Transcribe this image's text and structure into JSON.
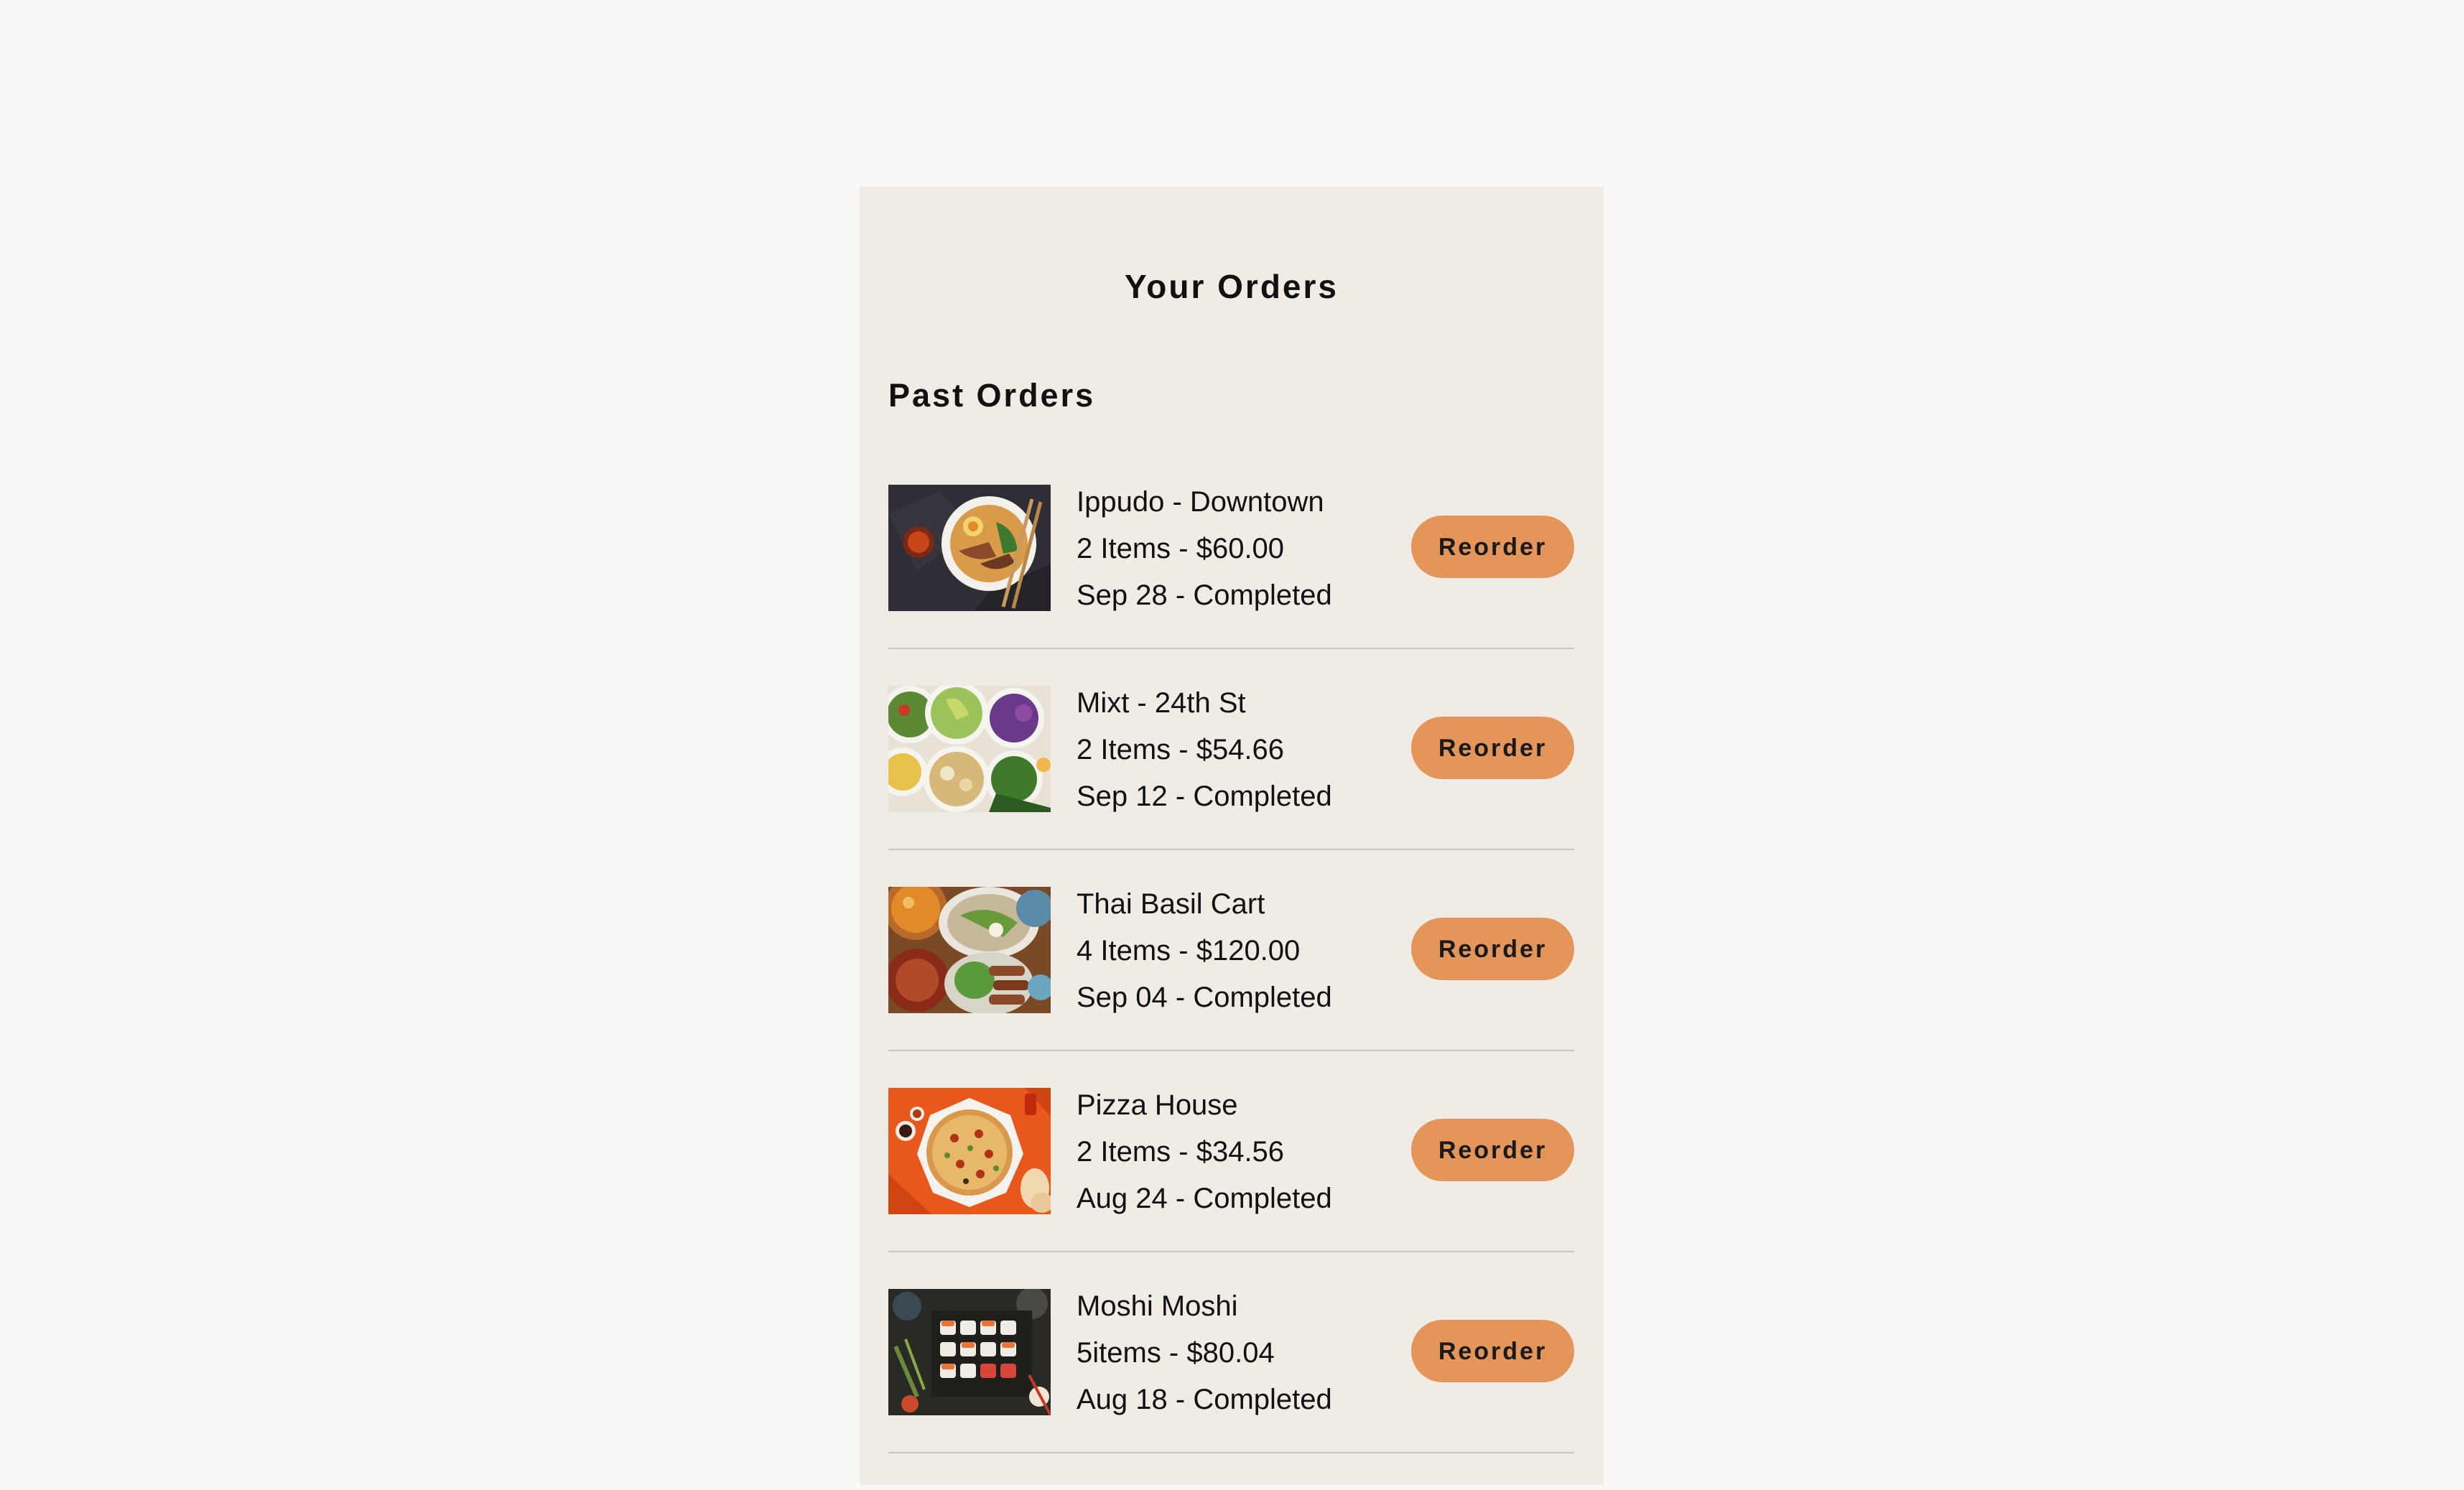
{
  "header": {
    "title": "Your Orders"
  },
  "section": {
    "title": "Past Orders"
  },
  "orders": [
    {
      "restaurant": "Ippudo - Downtown",
      "summary": "2 Items - $60.00",
      "status": "Sep 28 - Completed",
      "button": "Reorder",
      "image_icon": "ramen-bowl-photo"
    },
    {
      "restaurant": "Mixt - 24th St",
      "summary": "2 Items - $54.66",
      "status": "Sep 12 - Completed",
      "button": "Reorder",
      "image_icon": "salad-bowls-photo"
    },
    {
      "restaurant": "Thai Basil Cart",
      "summary": "4 Items - $120.00",
      "status": "Sep 04 - Completed",
      "button": "Reorder",
      "image_icon": "thai-dishes-photo"
    },
    {
      "restaurant": "Pizza House",
      "summary": "2 Items - $34.56",
      "status": "Aug 24 - Completed",
      "button": "Reorder",
      "image_icon": "pizza-photo"
    },
    {
      "restaurant": "Moshi Moshi",
      "summary": "5items - $80.04",
      "status": "Aug 18 - Completed",
      "button": "Reorder",
      "image_icon": "sushi-platter-photo"
    }
  ],
  "colors": {
    "page_background": "#f8f8f7",
    "panel_background": "#f0ebe4",
    "button": "#e4955a",
    "divider": "#cdc8c2"
  }
}
